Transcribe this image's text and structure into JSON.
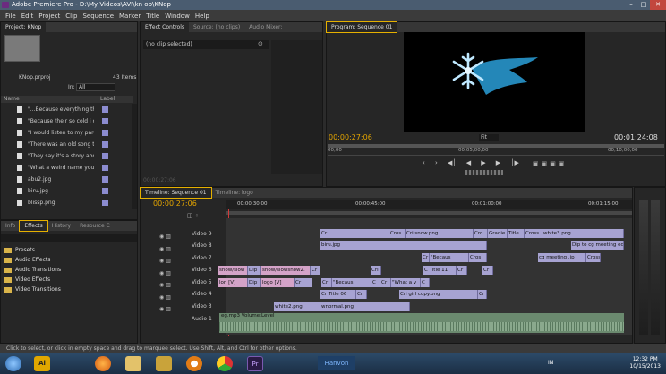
{
  "window": {
    "title": "Adobe Premiere Pro - D:\\My Videos\\AVI\\kn op\\KNop"
  },
  "menu": [
    "File",
    "Edit",
    "Project",
    "Clip",
    "Sequence",
    "Marker",
    "Title",
    "Window",
    "Help"
  ],
  "project": {
    "tab": "Project: KNop",
    "file": "KNop.prproj",
    "items_count": "43 Items",
    "in_label": "In:",
    "in_value": "All",
    "col_name": "Name",
    "col_label": "Label",
    "items": [
      "\"...Because everything that",
      "\"Because their so cold i ca",
      "\"I would listen to my pare",
      "\"There was an old song th",
      "\"They say it's a story abou",
      "\"What a weird name you h",
      "abu2.jpg",
      "biru.jpg",
      "blissp.png"
    ]
  },
  "effects": {
    "tabs": [
      "Info",
      "Effects",
      "History",
      "Resource C"
    ],
    "items": [
      "Presets",
      "Audio Effects",
      "Audio Transitions",
      "Video Effects",
      "Video Transitions"
    ]
  },
  "effect_controls": {
    "tabs": [
      "Effect Controls",
      "Source: (no clips)",
      "Audio Mixer:"
    ],
    "no_clip": "(no clip selected)",
    "timecode": "00:00:27:06"
  },
  "program": {
    "tab": "Program: Sequence 01",
    "timecode": "00:00:27:06",
    "fit": "Fit",
    "duration": "00:01:24:08",
    "ruler": [
      "00;00",
      "00;05;00;00",
      "00;10;00;00"
    ]
  },
  "timeline": {
    "tabs": [
      "Timeline: Sequence 01",
      "Timeline: logo"
    ],
    "timecode": "00:00:27:06",
    "ruler": [
      "00:00:30:00",
      "00:00:45:00",
      "00:01:00:00",
      "00:01:15:00"
    ],
    "tracks": [
      "Video 9",
      "Video 8",
      "Video 7",
      "Video 6",
      "Video 5",
      "Video 4",
      "Video 3",
      "Audio 1"
    ],
    "clips": {
      "v9": [
        "Cr",
        "Cros",
        "Cri snow.png",
        "Cro",
        "Gradie",
        "Title",
        "Cross",
        "white3.png"
      ],
      "v8": [
        "biru.jpg",
        "Dip to cg meeting edit"
      ],
      "v7": [
        "Cr",
        "\"Becaus",
        "Cros",
        "cg meeting .jp",
        "Cross"
      ],
      "v6": [
        "snow/slow",
        "Dip",
        "snow/slowsnow2.",
        "Cr",
        "Cri",
        "C Title 11",
        "Cr",
        "Cr"
      ],
      "v5": [
        "lon [V]",
        "Dip",
        "logo [V]",
        "Cr",
        "Cr",
        "\"Becaus",
        "C",
        "Cr",
        "\"What a v",
        "C"
      ],
      "v4": [
        "Cr Title 06",
        "Cr",
        "Cri girl copy.png",
        "Cr"
      ],
      "v3": [
        "white2.png",
        "wnormal.png"
      ],
      "a1": "eg.mp3 Volume:Level"
    }
  },
  "status": "Click to select, or click in empty space and drag to marquee select. Use Shift, Alt, and Ctrl for other options.",
  "taskbar": {
    "watermark": "Hanvon",
    "lang": "IN",
    "time": "12:32 PM",
    "date": "10/15/2013"
  }
}
